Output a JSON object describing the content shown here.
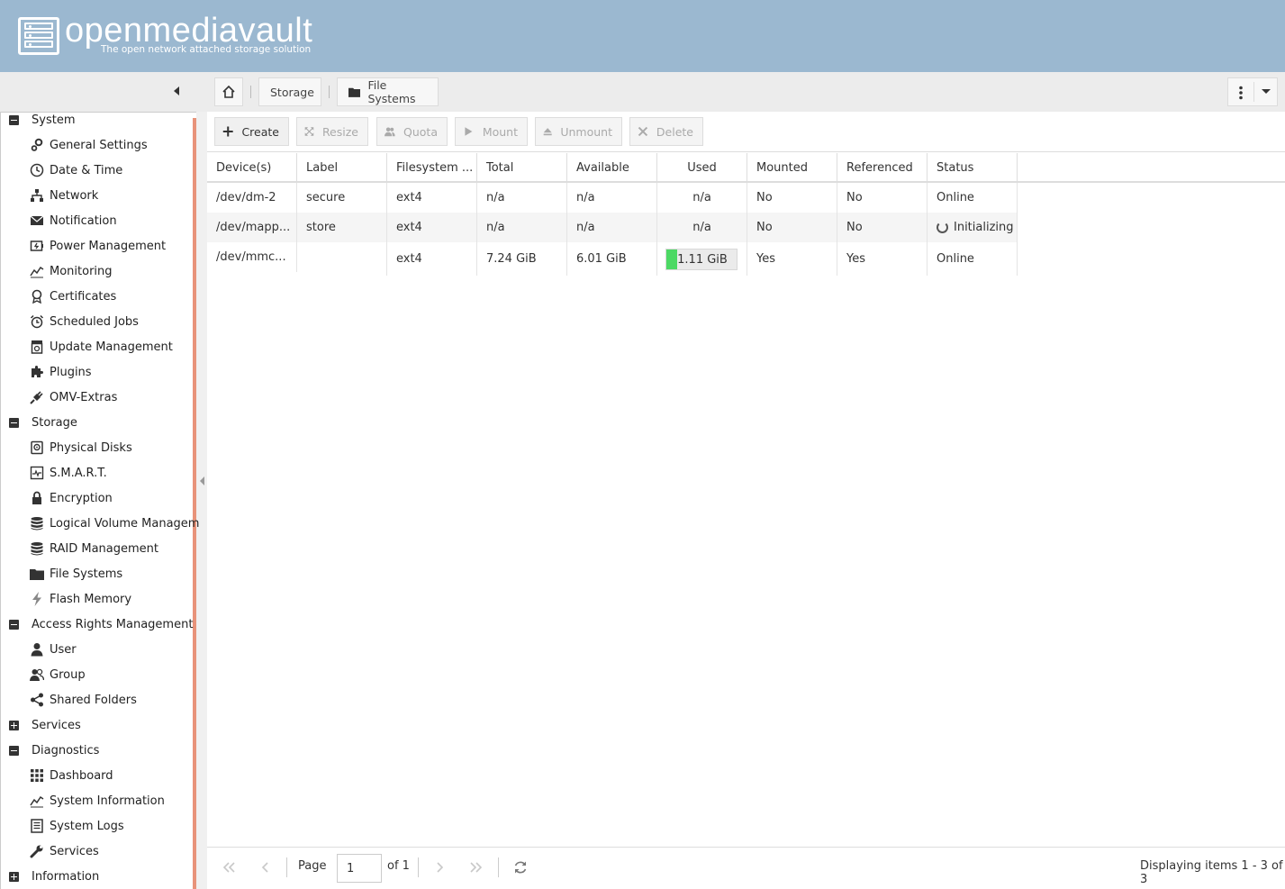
{
  "header": {
    "logo_text": "openmediavault",
    "tagline": "The open network attached storage solution"
  },
  "breadcrumb": {
    "items": [
      {
        "label": "Storage"
      },
      {
        "label": "File Systems"
      }
    ]
  },
  "sidebar": {
    "groups": [
      {
        "label": "System",
        "expanded": true,
        "items": [
          "General Settings",
          "Date & Time",
          "Network",
          "Notification",
          "Power Management",
          "Monitoring",
          "Certificates",
          "Scheduled Jobs",
          "Update Management",
          "Plugins",
          "OMV-Extras"
        ]
      },
      {
        "label": "Storage",
        "expanded": true,
        "items": [
          "Physical Disks",
          "S.M.A.R.T.",
          "Encryption",
          "Logical Volume Managem",
          "RAID Management",
          "File Systems",
          "Flash Memory"
        ]
      },
      {
        "label": "Access Rights Management",
        "expanded": true,
        "items": [
          "User",
          "Group",
          "Shared Folders"
        ]
      },
      {
        "label": "Services",
        "expanded": false,
        "items": []
      },
      {
        "label": "Diagnostics",
        "expanded": true,
        "items": [
          "Dashboard",
          "System Information",
          "System Logs",
          "Services"
        ]
      },
      {
        "label": "Information",
        "expanded": false,
        "items": []
      }
    ]
  },
  "toolbar": {
    "create": "Create",
    "resize": "Resize",
    "quota": "Quota",
    "mount": "Mount",
    "unmount": "Unmount",
    "delete": "Delete"
  },
  "grid": {
    "columns": [
      "Device(s)",
      "Label",
      "Filesystem ...",
      "Total",
      "Available",
      "Used",
      "Mounted",
      "Referenced",
      "Status"
    ],
    "rows": [
      {
        "device": "/dev/dm-2",
        "label": "secure",
        "fs": "ext4",
        "total": "n/a",
        "available": "n/a",
        "used": "n/a",
        "mounted": "No",
        "referenced": "No",
        "status": "Online"
      },
      {
        "device": "/dev/mapp...",
        "label": "store",
        "fs": "ext4",
        "total": "n/a",
        "available": "n/a",
        "used": "n/a",
        "mounted": "No",
        "referenced": "No",
        "status": "Initializing"
      },
      {
        "device": "/dev/mmc...",
        "label": "",
        "fs": "ext4",
        "total": "7.24 GiB",
        "available": "6.01 GiB",
        "used": "1.11 GiB",
        "used_fraction": 0.15,
        "mounted": "Yes",
        "referenced": "Yes",
        "status": "Online"
      }
    ]
  },
  "pager": {
    "page_label": "Page",
    "page_value": "1",
    "of_label": "of 1",
    "display_info": "Displaying items 1 - 3 of 3"
  },
  "colors": {
    "header_bg": "#9bb8d0",
    "sidebar_accent": "#e8937a",
    "used_bar": "#4cd964"
  }
}
